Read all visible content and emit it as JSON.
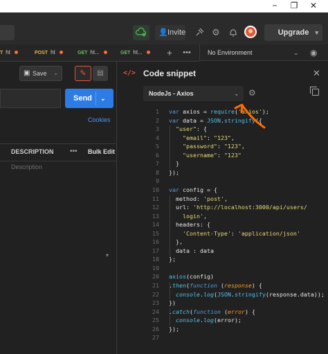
{
  "window": {
    "minimize": "−",
    "restore": "❐",
    "close": "✕"
  },
  "topbar": {
    "invite_label": "Invite",
    "upgrade_label": "Upgrade",
    "icons": [
      "sync-icon",
      "satellite-icon",
      "gear-icon",
      "bell-icon",
      "avatar"
    ]
  },
  "tabs": [
    {
      "method": "T",
      "label": "ht",
      "method_color": "post",
      "unsaved": true
    },
    {
      "method": "POST",
      "label": "ht",
      "method_color": "post",
      "unsaved": true
    },
    {
      "method": "GET",
      "label": "ht...",
      "method_color": "get",
      "unsaved": true
    },
    {
      "method": "GET",
      "label": "ht...",
      "method_color": "get",
      "unsaved": true
    }
  ],
  "tab_add": "+",
  "tab_more": "•••",
  "environment": {
    "selected": "No Environment"
  },
  "request": {
    "save_label": "Save",
    "send_label": "Send",
    "cookies_label": "Cookies",
    "table_header_description": "DESCRIPTION",
    "bulk_edit_label": "Bulk Edit",
    "description_placeholder": "Description"
  },
  "snippet": {
    "title": "Code snippet",
    "language": "NodeJs - Axios",
    "lines": [
      [
        [
          "var",
          "kw"
        ],
        [
          " axios = ",
          "pl"
        ],
        [
          "require",
          "fn"
        ],
        [
          "(",
          "pl"
        ],
        [
          "'axios'",
          "str"
        ],
        [
          ");",
          "pl"
        ]
      ],
      [
        [
          "var",
          "kw"
        ],
        [
          " data = ",
          "pl"
        ],
        [
          "JSON",
          "fn"
        ],
        [
          ".",
          "pl"
        ],
        [
          "stringify",
          "fn"
        ],
        [
          "({",
          "pl"
        ]
      ],
      [
        [
          "  \"user\"",
          "str"
        ],
        [
          ": {",
          "pl"
        ]
      ],
      [
        [
          "    \"email\"",
          "str"
        ],
        [
          ": ",
          "pl"
        ],
        [
          "\"123\"",
          "str"
        ],
        [
          ",",
          "pl"
        ]
      ],
      [
        [
          "    \"password\"",
          "str"
        ],
        [
          ": ",
          "pl"
        ],
        [
          "\"123\"",
          "str"
        ],
        [
          ",",
          "pl"
        ]
      ],
      [
        [
          "    \"username\"",
          "str"
        ],
        [
          ": ",
          "pl"
        ],
        [
          "\"123\"",
          "str"
        ]
      ],
      [
        [
          "  }",
          "pl"
        ]
      ],
      [
        [
          "});",
          "pl"
        ]
      ],
      [
        [
          "",
          "pl"
        ]
      ],
      [
        [
          "var",
          "kw"
        ],
        [
          " config = {",
          "pl"
        ]
      ],
      [
        [
          "  method: ",
          "pl"
        ],
        [
          "'post'",
          "str"
        ],
        [
          ",",
          "pl"
        ]
      ],
      [
        [
          "  url: ",
          "pl"
        ],
        [
          "'http://localhost:3000/api/users/",
          "str"
        ]
      ],
      [
        [
          "    login'",
          "str"
        ],
        [
          ",",
          "pl"
        ]
      ],
      [
        [
          "  headers: {",
          "pl"
        ]
      ],
      [
        [
          "    ",
          "pl"
        ],
        [
          "'Content-Type'",
          "str"
        ],
        [
          ": ",
          "pl"
        ],
        [
          "'application/json'",
          "str"
        ]
      ],
      [
        [
          "  },",
          "pl"
        ]
      ],
      [
        [
          "  data : data",
          "pl"
        ]
      ],
      [
        [
          "};",
          "pl"
        ]
      ],
      [
        [
          "",
          "pl"
        ]
      ],
      [
        [
          "axios",
          "fn"
        ],
        [
          "(config)",
          "pl"
        ]
      ],
      [
        [
          ".",
          "pl"
        ],
        [
          "then",
          "fn"
        ],
        [
          "(",
          "pl"
        ],
        [
          "function",
          "kw"
        ],
        [
          " (",
          "pl"
        ],
        [
          "response",
          "arg"
        ],
        [
          ") {",
          "pl"
        ]
      ],
      [
        [
          "  ",
          "pl"
        ],
        [
          "console",
          "fn"
        ],
        [
          ".",
          "pl"
        ],
        [
          "log",
          "fn"
        ],
        [
          "(",
          "pl"
        ],
        [
          "JSON",
          "fn"
        ],
        [
          ".",
          "pl"
        ],
        [
          "stringify",
          "fn"
        ],
        [
          "(response.data));",
          "pl"
        ]
      ],
      [
        [
          "})",
          "pl"
        ]
      ],
      [
        [
          ".",
          "pl"
        ],
        [
          "catch",
          "fn"
        ],
        [
          "(",
          "pl"
        ],
        [
          "function",
          "kw"
        ],
        [
          " (",
          "pl"
        ],
        [
          "error",
          "arg"
        ],
        [
          ") {",
          "pl"
        ]
      ],
      [
        [
          "  ",
          "pl"
        ],
        [
          "console",
          "fn"
        ],
        [
          ".",
          "pl"
        ],
        [
          "log",
          "fn"
        ],
        [
          "(error);",
          "pl"
        ]
      ],
      [
        [
          "});",
          "pl"
        ]
      ],
      [
        [
          "",
          "pl"
        ]
      ]
    ]
  },
  "colors": {
    "accent": "#ff6c37",
    "send_blue": "#2d7be5",
    "kw": "#569cd6",
    "fn": "#4fc1e9",
    "str": "#e6db74",
    "arg": "#fd971f",
    "pl": "#e8e8e8",
    "annotation": "#ff6c00"
  }
}
